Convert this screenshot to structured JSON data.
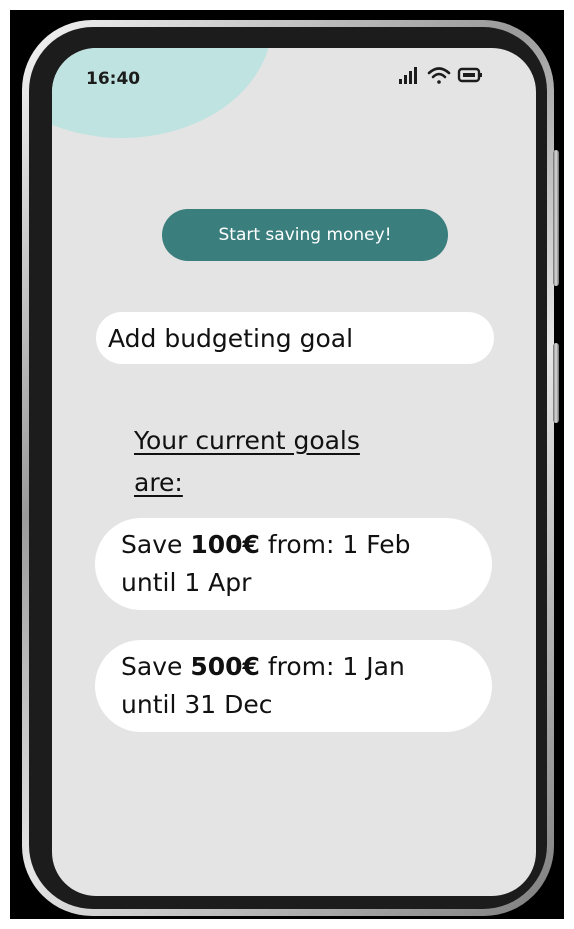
{
  "status_bar": {
    "time": "16:40"
  },
  "cta": {
    "label": "Start saving money!"
  },
  "add_goal": {
    "label": "Add budgeting goal"
  },
  "goals_heading": {
    "line1": "Your current goals",
    "line2": "are:"
  },
  "goals": [
    {
      "prefix": "Save ",
      "amount": "100€",
      "from_label": " from:  1 Feb",
      "until": "until 1 Apr"
    },
    {
      "prefix": "Save ",
      "amount": "500€",
      "from_label": " from:  1 Jan",
      "until": "until 31 Dec"
    }
  ],
  "colors": {
    "accent": "#3b7e7e",
    "decor": "#bfe3e1",
    "screen_bg": "#e4e4e4",
    "card_bg": "#ffffff"
  },
  "icons": [
    "signal-icon",
    "wifi-icon",
    "battery-icon"
  ]
}
